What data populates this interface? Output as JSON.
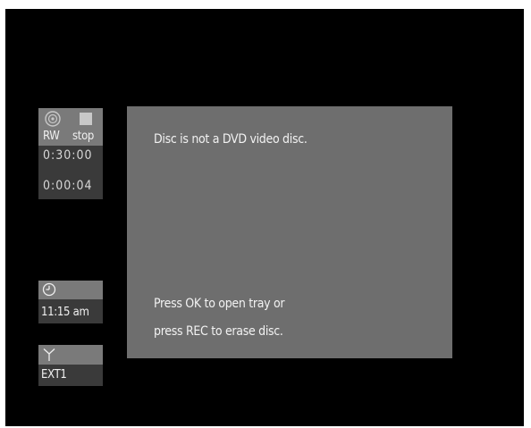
{
  "disc_status": {
    "disc_icon": "disc-icon",
    "stop_icon": "stop-icon",
    "disc_type": "RW",
    "state": "stop",
    "total_time": "0:30:00",
    "elapsed_time": "0:00:04"
  },
  "clock": {
    "icon": "clock-icon",
    "time": "11:15 am"
  },
  "source": {
    "icon": "antenna-icon",
    "name": "EXT1"
  },
  "message": {
    "title": "Disc is not a DVD video disc.",
    "line1": "Press OK to open tray or",
    "line2": "press REC to erase disc."
  }
}
